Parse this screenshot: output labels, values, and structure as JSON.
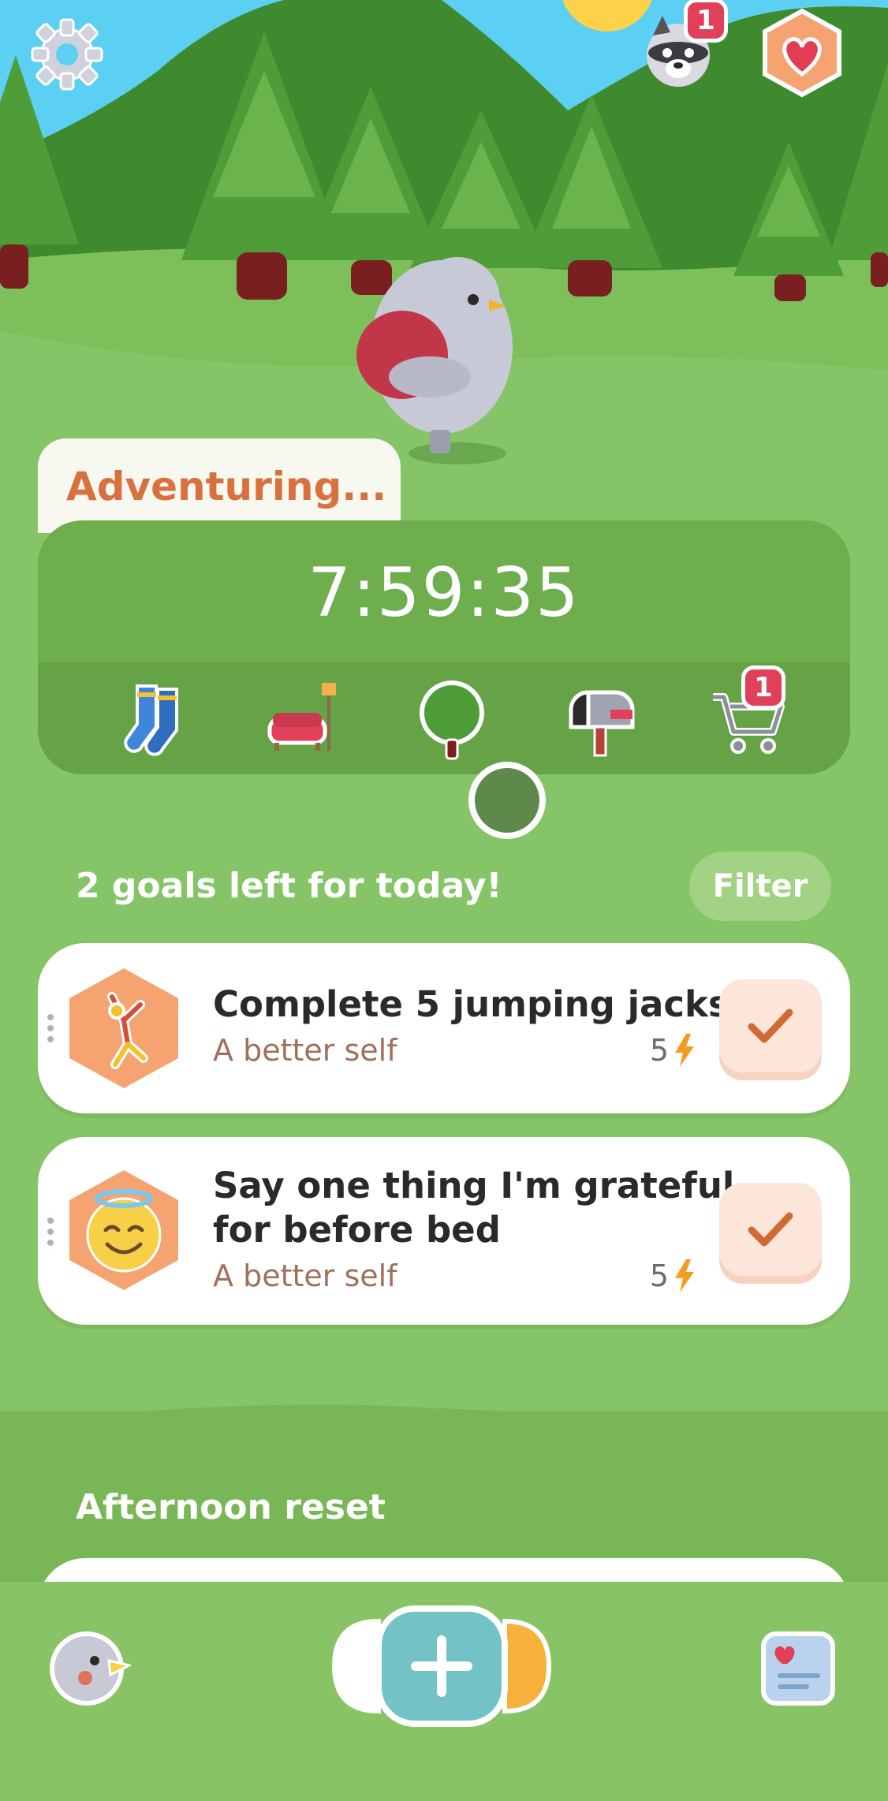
{
  "status": {
    "label": "Adventuring...",
    "timer": "7:59:35"
  },
  "hud": {
    "settings_icon": "gear-icon",
    "friends_badge": "1",
    "heart_icon": "heart-icon"
  },
  "tray": {
    "items": [
      "socks-icon",
      "sofa-icon",
      "tree-icon",
      "mailbox-icon",
      "cart-icon"
    ],
    "cart_badge": "1"
  },
  "goals": {
    "header": "2 goals left for today!",
    "filter_label": "Filter",
    "items": [
      {
        "title": "Complete 5 jumping jacks",
        "category": "A better self",
        "points": "5",
        "icon": "jumping-person-icon"
      },
      {
        "title_line1": "Say one thing I'm grateful",
        "title_line2": "for before bed",
        "category": "A better self",
        "points": "5",
        "icon": "halo-smile-icon"
      }
    ]
  },
  "section": {
    "title": "Afternoon reset"
  },
  "nav": {
    "left_icon": "bird-avatar-icon",
    "center_icon": "plus-icon",
    "right_icon": "journal-icon"
  },
  "colors": {
    "accent_orange": "#d9713e",
    "grass": "#86c567",
    "badge_red": "#e2405a",
    "teal": "#6fc1c8"
  }
}
